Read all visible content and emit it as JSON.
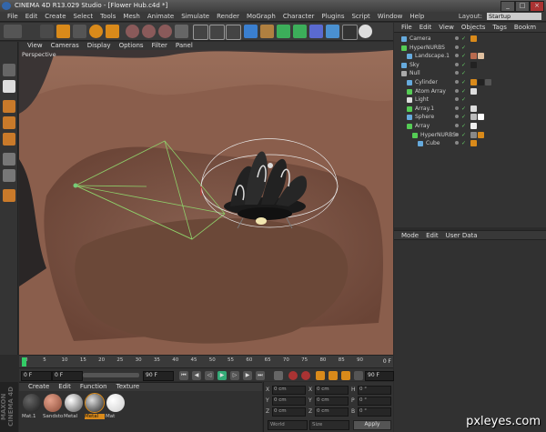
{
  "window": {
    "title": "CINEMA 4D R13.029 Studio - [Flower Hub.c4d *]",
    "controls": [
      "_",
      "□",
      "×"
    ]
  },
  "menu": [
    "File",
    "Edit",
    "Create",
    "Select",
    "Tools",
    "Mesh",
    "Animate",
    "Simulate",
    "Render",
    "MoGraph",
    "Character",
    "Plugins",
    "Script",
    "Window",
    "Help"
  ],
  "layout": {
    "label": "Layout:",
    "value": "Startup"
  },
  "viewport_menu": [
    "View",
    "Cameras",
    "Display",
    "Options",
    "Filter",
    "Panel"
  ],
  "viewport_label": "Perspective",
  "timeline": {
    "ticks": [
      "0",
      "5",
      "10",
      "15",
      "20",
      "25",
      "30",
      "35",
      "40",
      "45",
      "50",
      "55",
      "60",
      "65",
      "70",
      "75",
      "80",
      "85",
      "90"
    ],
    "end_label": "0 F"
  },
  "transport": {
    "start": "0 F",
    "current": "0 F",
    "end": "90 F",
    "end2": "90 F"
  },
  "materials": {
    "menu": [
      "Create",
      "Edit",
      "Function",
      "Texture"
    ],
    "items": [
      {
        "label": "Mat.1",
        "color": "#2a2a2a"
      },
      {
        "label": "Sandsto",
        "color": "#b86a4e"
      },
      {
        "label": "Metal",
        "color": "#9a9a9a"
      },
      {
        "label": "Metal",
        "color": "#5a5a5a",
        "selected": true
      },
      {
        "label": "Mat",
        "color": "#f0f0f0"
      }
    ]
  },
  "coordinates": {
    "rows": [
      {
        "a": "X",
        "av": "0 cm",
        "b": "X",
        "bv": "0 cm",
        "c": "H",
        "cv": "0 °"
      },
      {
        "a": "Y",
        "av": "0 cm",
        "b": "Y",
        "bv": "0 cm",
        "c": "P",
        "cv": "0 °"
      },
      {
        "a": "Z",
        "av": "0 cm",
        "b": "Z",
        "bv": "0 cm",
        "c": "B",
        "cv": "0 °"
      }
    ],
    "mode": "World",
    "size": "Size",
    "apply": "Apply"
  },
  "object_menu": [
    "File",
    "Edit",
    "View",
    "Objects",
    "Tags",
    "Bookm"
  ],
  "objects": [
    {
      "name": "Camera",
      "indent": 0,
      "icon": "#6ad"
    },
    {
      "name": "HyperNURBS",
      "indent": 0,
      "icon": "#5c5"
    },
    {
      "name": "Landscape.1",
      "indent": 1,
      "icon": "#6ad"
    },
    {
      "name": "Sky",
      "indent": 0,
      "icon": "#6ad"
    },
    {
      "name": "Null",
      "indent": 0,
      "icon": "#aaa"
    },
    {
      "name": "Cylinder",
      "indent": 1,
      "icon": "#6ad"
    },
    {
      "name": "Atom Array",
      "indent": 1,
      "icon": "#5c5"
    },
    {
      "name": "Light",
      "indent": 1,
      "icon": "#ddd"
    },
    {
      "name": "Array.1",
      "indent": 1,
      "icon": "#5c5"
    },
    {
      "name": "Sphere",
      "indent": 1,
      "icon": "#6ad"
    },
    {
      "name": "Array",
      "indent": 1,
      "icon": "#5c5"
    },
    {
      "name": "HyperNURBS",
      "indent": 2,
      "icon": "#5c5"
    },
    {
      "name": "Cube",
      "indent": 3,
      "icon": "#6ad"
    }
  ],
  "attr_menu": [
    "Mode",
    "Edit",
    "User Data"
  ],
  "brand": "MAXON CINEMA 4D",
  "watermark": "pxleyes.com"
}
